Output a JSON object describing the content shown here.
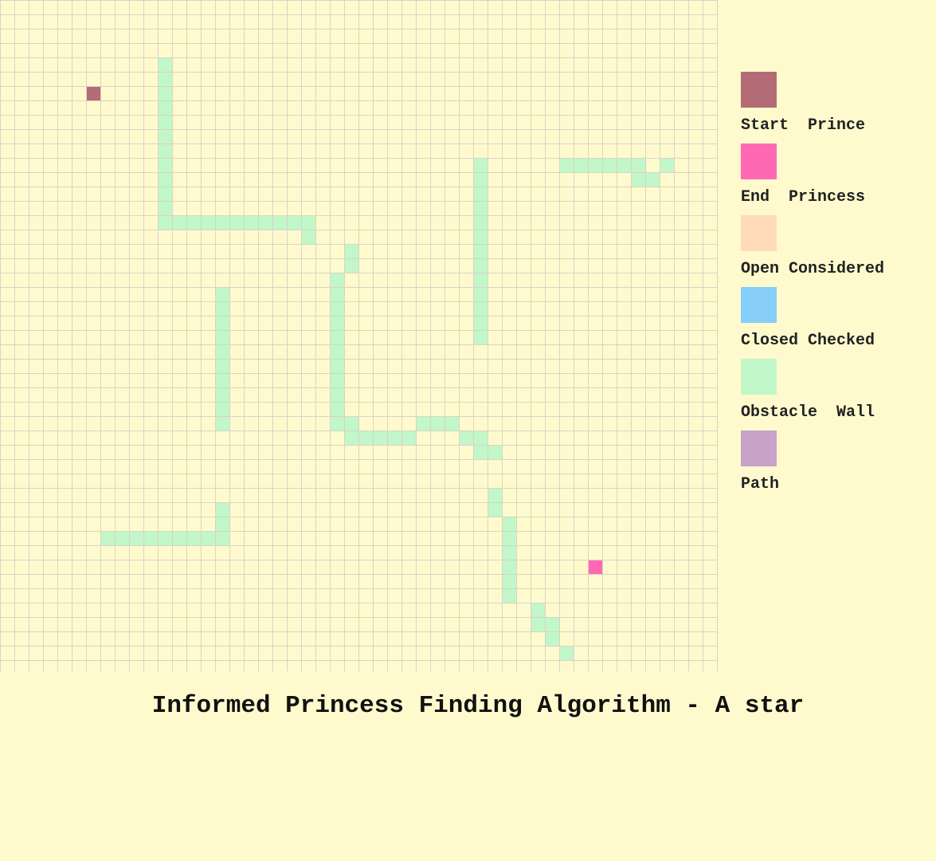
{
  "title": "Informed Princess Finding Algorithm - A star",
  "grid": {
    "cols": 50,
    "rows": 47,
    "background": "#fffacd",
    "grid_line_color": "#d9d4c4",
    "start": {
      "col": 6,
      "row": 6,
      "color": "#b36b76"
    },
    "end": {
      "col": 41,
      "row": 39,
      "color": "#ff69b4"
    },
    "obstacle_color": "#c1f7c9",
    "obstacles": [
      [
        11,
        4
      ],
      [
        11,
        5
      ],
      [
        11,
        6
      ],
      [
        11,
        7
      ],
      [
        11,
        8
      ],
      [
        11,
        9
      ],
      [
        11,
        10
      ],
      [
        11,
        11
      ],
      [
        11,
        12
      ],
      [
        11,
        13
      ],
      [
        11,
        14
      ],
      [
        11,
        15
      ],
      [
        12,
        15
      ],
      [
        13,
        15
      ],
      [
        14,
        15
      ],
      [
        15,
        15
      ],
      [
        16,
        15
      ],
      [
        17,
        15
      ],
      [
        18,
        15
      ],
      [
        19,
        15
      ],
      [
        20,
        15
      ],
      [
        21,
        15
      ],
      [
        21,
        16
      ],
      [
        15,
        20
      ],
      [
        15,
        21
      ],
      [
        15,
        22
      ],
      [
        15,
        23
      ],
      [
        15,
        24
      ],
      [
        15,
        25
      ],
      [
        15,
        26
      ],
      [
        15,
        27
      ],
      [
        15,
        28
      ],
      [
        15,
        29
      ],
      [
        24,
        17
      ],
      [
        24,
        18
      ],
      [
        23,
        19
      ],
      [
        23,
        20
      ],
      [
        23,
        21
      ],
      [
        23,
        22
      ],
      [
        23,
        23
      ],
      [
        23,
        24
      ],
      [
        23,
        25
      ],
      [
        23,
        26
      ],
      [
        23,
        27
      ],
      [
        23,
        28
      ],
      [
        23,
        29
      ],
      [
        24,
        29
      ],
      [
        33,
        11
      ],
      [
        33,
        12
      ],
      [
        33,
        13
      ],
      [
        33,
        14
      ],
      [
        33,
        15
      ],
      [
        33,
        16
      ],
      [
        33,
        17
      ],
      [
        33,
        18
      ],
      [
        33,
        19
      ],
      [
        33,
        20
      ],
      [
        33,
        21
      ],
      [
        33,
        22
      ],
      [
        33,
        23
      ],
      [
        39,
        11
      ],
      [
        40,
        11
      ],
      [
        41,
        11
      ],
      [
        42,
        11
      ],
      [
        43,
        11
      ],
      [
        44,
        11
      ],
      [
        46,
        11
      ],
      [
        44,
        12
      ],
      [
        45,
        12
      ],
      [
        24,
        30
      ],
      [
        25,
        30
      ],
      [
        26,
        30
      ],
      [
        27,
        30
      ],
      [
        28,
        30
      ],
      [
        29,
        29
      ],
      [
        30,
        29
      ],
      [
        31,
        29
      ],
      [
        32,
        30
      ],
      [
        33,
        30
      ],
      [
        33,
        31
      ],
      [
        34,
        31
      ],
      [
        34,
        34
      ],
      [
        34,
        35
      ],
      [
        35,
        36
      ],
      [
        35,
        37
      ],
      [
        35,
        38
      ],
      [
        35,
        39
      ],
      [
        35,
        40
      ],
      [
        35,
        41
      ],
      [
        37,
        42
      ],
      [
        37,
        43
      ],
      [
        38,
        43
      ],
      [
        38,
        44
      ],
      [
        39,
        45
      ],
      [
        15,
        35
      ],
      [
        15,
        36
      ],
      [
        15,
        37
      ],
      [
        7,
        37
      ],
      [
        8,
        37
      ],
      [
        9,
        37
      ],
      [
        10,
        37
      ],
      [
        11,
        37
      ],
      [
        12,
        37
      ],
      [
        13,
        37
      ],
      [
        14,
        37
      ]
    ]
  },
  "legend": [
    {
      "label": "Start  Prince",
      "color": "#b36b76"
    },
    {
      "label": "End  Princess",
      "color": "#ff69b4"
    },
    {
      "label": "Open Considered",
      "color": "#ffdab9"
    },
    {
      "label": "Closed Checked",
      "color": "#87cefa"
    },
    {
      "label": "Obstacle  Wall",
      "color": "#c1f7c9"
    },
    {
      "label": "Path",
      "color": "#c8a2c8"
    }
  ]
}
